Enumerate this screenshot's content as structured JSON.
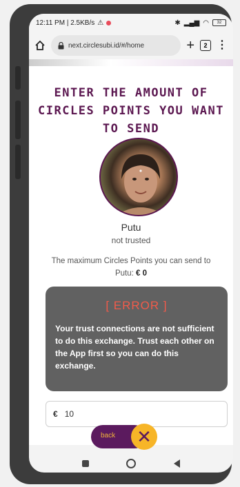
{
  "status": {
    "time_and_speed": "12:11 PM | 2.5KB/s",
    "battery": "32"
  },
  "browser": {
    "url": "next.circlesubi.id/#/home",
    "tab_count": "2"
  },
  "page": {
    "title": "ENTER THE AMOUNT OF CIRCLES POINTS YOU WANT TO SEND",
    "recipient_name": "Putu",
    "trust_status": "not trusted",
    "max_text": "The maximum Circles Points you can send to Putu:",
    "max_value": "€ 0"
  },
  "error": {
    "title": "[ ERROR ]",
    "message": "Your trust connections are not sufficient to do this exchange. Trust each other on the App first so you can do this exchange."
  },
  "amount": {
    "currency_symbol": "€",
    "value": "10"
  },
  "actions": {
    "back_label": "back",
    "close_symbol": "✕"
  },
  "colors": {
    "brand_purple": "#5b1a5e",
    "accent_yellow": "#f7b528",
    "error_red": "#f25b4a"
  }
}
